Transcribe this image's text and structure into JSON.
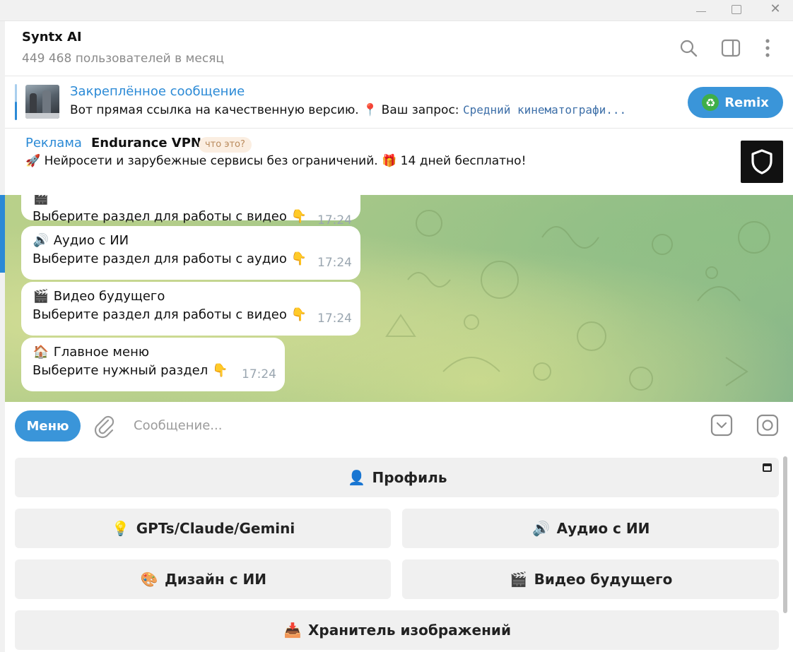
{
  "window": {
    "minimize_icon": "minimize-icon",
    "maximize_icon": "maximize-icon",
    "close_icon": "close-icon",
    "close_glyph": "✕"
  },
  "header": {
    "title": "Syntx AI",
    "subtitle": "449 468 пользователей в месяц",
    "icons": [
      "search-icon",
      "sidebar-toggle-icon",
      "more-vertical-icon"
    ]
  },
  "pinned": {
    "title": "Закреплённое сообщение",
    "text_prefix": "Вот прямая ссылка на качественную версию. 📍 Ваш запрос: ",
    "text_code": "Средний кинематографи...",
    "button_icon": "♻",
    "button_label": "Remix"
  },
  "ad": {
    "label": "Реклама",
    "name": "Endurance VPN",
    "what_label": "что это?",
    "text": "🚀 Нейросети и зарубежные сервисы без ограничений. 🎁 14 дней бесплатно!",
    "logo_icon": "shield-icon"
  },
  "messages": [
    {
      "line1": "",
      "emoji": "🎬",
      "line2": "Выберите раздел для работы с видео",
      "hand": "👇",
      "time": "17:24"
    },
    {
      "line1": "Аудио с ИИ",
      "emoji": "🔊",
      "line2": "Выберите раздел для работы с аудио",
      "hand": "👇",
      "time": "17:24"
    },
    {
      "line1": "Видео будущего",
      "emoji": "🎬",
      "line2": "Выберите раздел для работы с видео",
      "hand": "👇",
      "time": "17:24"
    },
    {
      "line1": "Главное меню",
      "emoji": "🏠",
      "line2": "Выберите нужный раздел",
      "hand": "👇",
      "time": "17:24"
    }
  ],
  "composer": {
    "menu_label": "Меню",
    "placeholder": "Сообщение...",
    "value": "",
    "icons": [
      "paperclip-icon",
      "keyboard-toggle-icon",
      "camera-icon"
    ]
  },
  "keyboard": {
    "buttons": [
      {
        "emoji": "👤",
        "label": "Профиль"
      },
      {
        "emoji": "💡",
        "label": "GPTs/Claude/Gemini"
      },
      {
        "emoji": "🔊",
        "label": "Аудио с ИИ"
      },
      {
        "emoji": "🎨",
        "label": "Дизайн с ИИ"
      },
      {
        "emoji": "🎬",
        "label": "Видео будущего"
      },
      {
        "emoji": "📥",
        "label": "Хранитель изображений"
      }
    ]
  },
  "colors": {
    "accent": "#3a95d9",
    "link": "#2b8ad6",
    "button_bg": "#f0f0f0",
    "time": "#9aa6b0"
  }
}
